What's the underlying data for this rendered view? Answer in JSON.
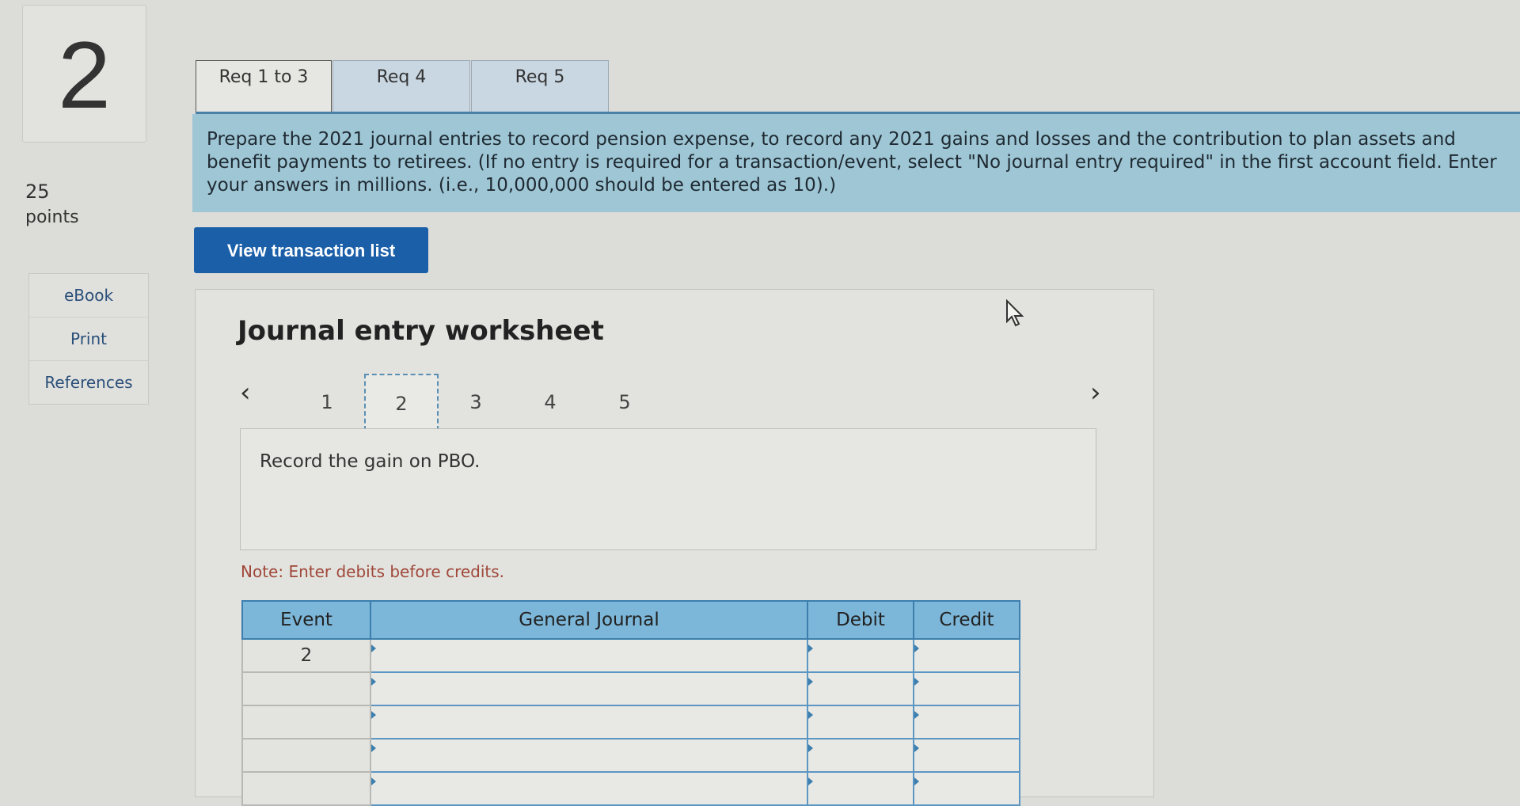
{
  "question": {
    "number": "2",
    "points_value": "25",
    "points_label": "points"
  },
  "sidebar": {
    "links": [
      {
        "label": "eBook"
      },
      {
        "label": "Print"
      },
      {
        "label": "References"
      }
    ]
  },
  "tabs": [
    {
      "label": "Req 1 to 3",
      "active": true
    },
    {
      "label": "Req 4",
      "active": false
    },
    {
      "label": "Req 5",
      "active": false
    }
  ],
  "instructions": "Prepare the 2021 journal entries to record pension expense, to record any 2021 gains and losses and the contribution to plan assets and benefit payments to retirees. (If no entry is required for a transaction/event, select \"No journal entry required\" in the first account field. Enter your answers in millions. (i.e., 10,000,000 should be entered as 10).)",
  "view_button": "View transaction list",
  "worksheet": {
    "title": "Journal entry worksheet",
    "prev_icon": "‹",
    "next_icon": "›",
    "steps": [
      "1",
      "2",
      "3",
      "4",
      "5"
    ],
    "active_step": "2",
    "record_text": "Record the gain on PBO.",
    "note": "Note: Enter debits before credits.",
    "table": {
      "headers": [
        "Event",
        "General Journal",
        "Debit",
        "Credit"
      ],
      "rows": [
        {
          "event": "2"
        },
        {
          "event": ""
        },
        {
          "event": ""
        },
        {
          "event": ""
        },
        {
          "event": ""
        }
      ]
    }
  },
  "colors": {
    "accent": "#1a5fa8",
    "instruction_bg": "#9ec6d4",
    "table_header": "#7cb6d8"
  }
}
